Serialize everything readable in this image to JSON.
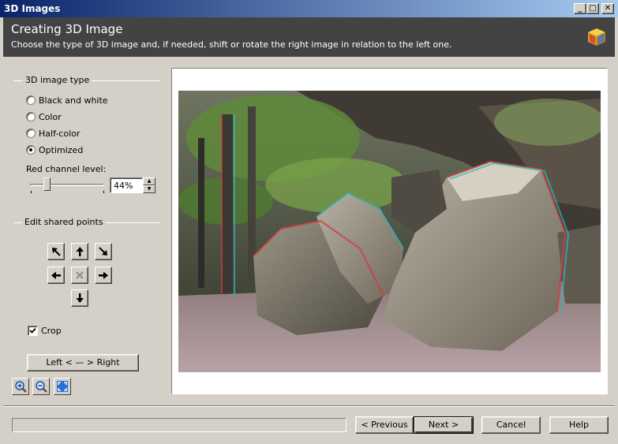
{
  "window": {
    "title": "3D Images",
    "minimize_glyph": "_",
    "maximize_glyph": "□",
    "close_glyph": "✕"
  },
  "header": {
    "title": "Creating 3D Image",
    "subtitle": "Choose the type of 3D image and, if needed, shift or rotate the right image in relation to the left one."
  },
  "image_type": {
    "group_label": "3D image type",
    "options": [
      {
        "label": "Black and white",
        "selected": false
      },
      {
        "label": "Color",
        "selected": false
      },
      {
        "label": "Half-color",
        "selected": false
      },
      {
        "label": "Optimized",
        "selected": true
      }
    ],
    "red_level_label": "Red channel level:",
    "red_level_value": "44%",
    "red_level_fraction": 0.44
  },
  "shared_points": {
    "group_label": "Edit shared points",
    "buttons": [
      "rotate-left-icon",
      "arrow-up-icon",
      "rotate-right-icon",
      "arrow-left-icon",
      "reset-x-icon",
      "arrow-right-icon",
      "arrow-down-icon"
    ]
  },
  "crop": {
    "label": "Crop",
    "checked": true
  },
  "swap_button": "Left < — > Right",
  "zoom": {
    "zoom_in": "zoom-in-icon",
    "zoom_out": "zoom-out-icon",
    "fit": "fit-window-icon"
  },
  "footer": {
    "previous": "< Previous",
    "next": "Next >",
    "cancel": "Cancel",
    "help": "Help"
  },
  "colors": {
    "header_bg": "#434343",
    "titlebar_start": "#0a246a",
    "titlebar_end": "#a6caf0",
    "dialog_bg": "#d4d0c8"
  }
}
